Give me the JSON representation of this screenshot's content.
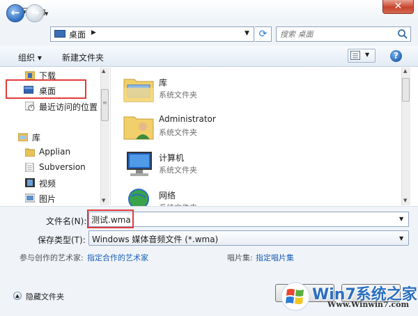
{
  "window": {
    "title": "另存为",
    "close_label": "✕"
  },
  "address": {
    "path": "桌面",
    "search_placeholder": "搜索 桌面"
  },
  "toolbar": {
    "organize_label": "组织 ▾",
    "new_folder_label": "新建文件夹",
    "help_label": "?"
  },
  "nav": {
    "items": [
      {
        "label": "下载",
        "icon": "download-folder-icon"
      },
      {
        "label": "桌面",
        "icon": "desktop-icon"
      },
      {
        "label": "最近访问的位置",
        "icon": "recent-places-icon"
      },
      {
        "label": "库",
        "icon": "library-icon"
      },
      {
        "label": "Applian",
        "icon": "folder-icon"
      },
      {
        "label": "Subversion",
        "icon": "document-icon"
      },
      {
        "label": "视频",
        "icon": "video-icon"
      },
      {
        "label": "图片",
        "icon": "picture-icon"
      }
    ]
  },
  "files": {
    "items": [
      {
        "name": "库",
        "type": "系统文件夹",
        "icon": "library-folder-icon"
      },
      {
        "name": "Administrator",
        "type": "系统文件夹",
        "icon": "user-folder-icon"
      },
      {
        "name": "计算机",
        "type": "系统文件夹",
        "icon": "computer-icon"
      },
      {
        "name": "网络",
        "type": "系统文件夹",
        "icon": "network-icon"
      }
    ]
  },
  "details": {
    "filename_label": "文件名(N):",
    "filename_value": "测试.wma",
    "savetype_label": "保存类型(T):",
    "savetype_value": "Windows 媒体音频文件 (*.wma)",
    "artist_label": "参与创作的艺术家:",
    "artist_link": "指定合作的艺术家",
    "album_label": "唱片集:",
    "album_link": "指定唱片集",
    "hide_folders_label": "隐藏文件夹"
  },
  "watermark": {
    "title": "Win7系统之家",
    "url": "Www.Winwin7.com"
  },
  "colors": {
    "highlight": "#e33a3a",
    "link": "#1a5fb4",
    "accent": "#2a6fbf"
  }
}
